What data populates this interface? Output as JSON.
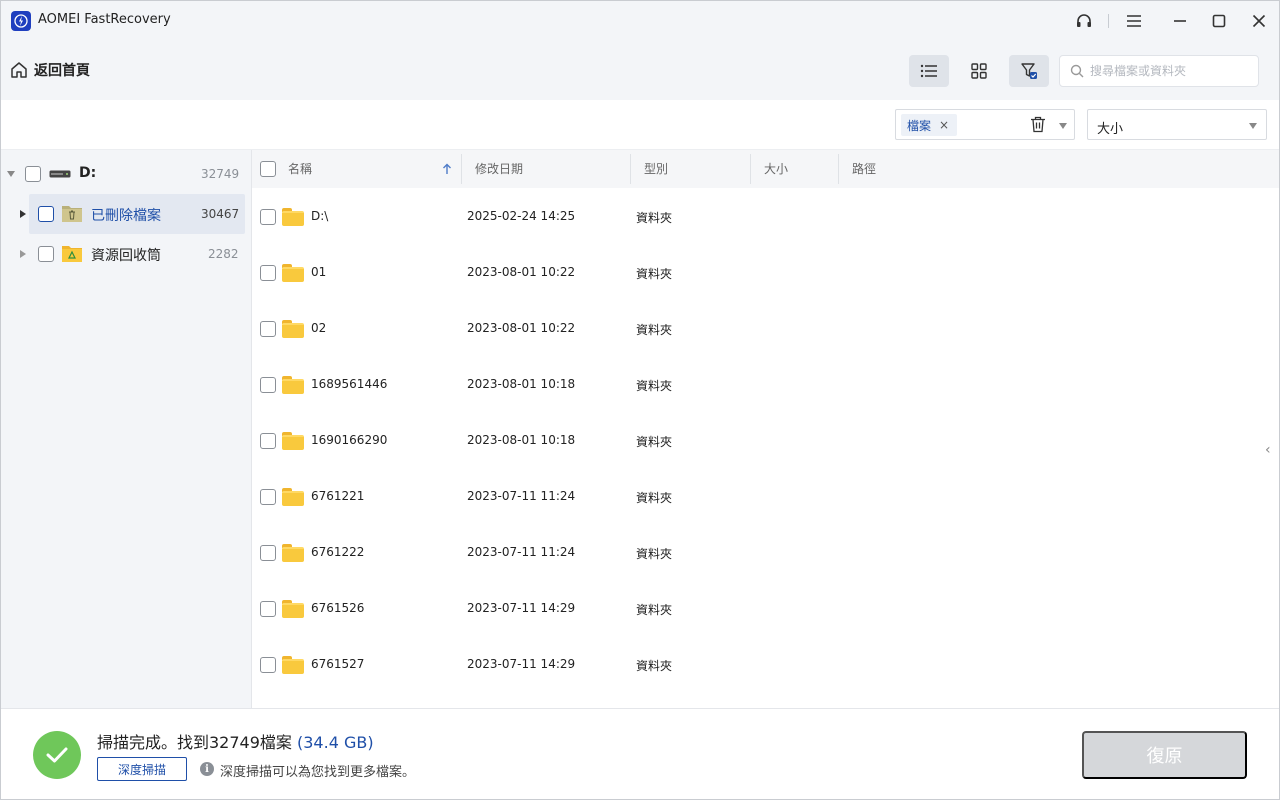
{
  "app": {
    "title": "AOMEI FastRecovery"
  },
  "toolbar": {
    "back_label": "返回首頁",
    "search_placeholder": "搜尋檔案或資料夾"
  },
  "filter": {
    "chip_label": "檔案",
    "chip_close": "×",
    "size_label": "大小"
  },
  "tree": {
    "drive": {
      "label": "D:",
      "count": "32749"
    },
    "items": [
      {
        "label": "已刪除檔案",
        "count": "30467",
        "icon": "deleted-folder-icon"
      },
      {
        "label": "資源回收筒",
        "count": "2282",
        "icon": "recycle-bin-folder-icon"
      }
    ]
  },
  "table": {
    "headers": {
      "name": "名稱",
      "modified": "修改日期",
      "type": "型別",
      "size": "大小",
      "path": "路徑"
    },
    "rows": [
      {
        "name": "D:\\",
        "date": "2025-02-24 14:25",
        "type": "資料夾"
      },
      {
        "name": "01",
        "date": "2023-08-01 10:22",
        "type": "資料夾"
      },
      {
        "name": "02",
        "date": "2023-08-01 10:22",
        "type": "資料夾"
      },
      {
        "name": "1689561446",
        "date": "2023-08-01 10:18",
        "type": "資料夾"
      },
      {
        "name": "1690166290",
        "date": "2023-08-01 10:18",
        "type": "資料夾"
      },
      {
        "name": "6761221",
        "date": "2023-07-11 11:24",
        "type": "資料夾"
      },
      {
        "name": "6761222",
        "date": "2023-07-11 11:24",
        "type": "資料夾"
      },
      {
        "name": "6761526",
        "date": "2023-07-11 14:29",
        "type": "資料夾"
      },
      {
        "name": "6761527",
        "date": "2023-07-11 14:29",
        "type": "資料夾"
      }
    ]
  },
  "footer": {
    "scan_message": "掃描完成。找到32749檔案",
    "scan_size": "(34.4 GB)",
    "deep_scan_label": "深度掃描",
    "hint": "深度掃描可以為您找到更多檔案。",
    "recover_label": "復原"
  },
  "colors": {
    "accent": "#1f4fa8",
    "success": "#6fc75a",
    "disabled": "#d5d7da"
  }
}
